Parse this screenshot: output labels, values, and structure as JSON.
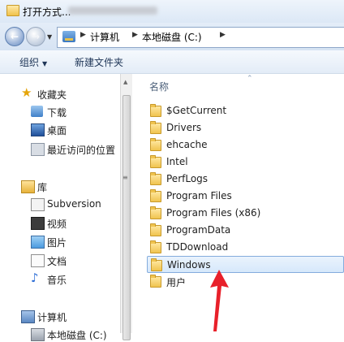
{
  "window": {
    "title": "打开方式..."
  },
  "address": {
    "crumbs": [
      "计算机",
      "本地磁盘 (C:)"
    ]
  },
  "toolbar": {
    "organize_label": "组织",
    "new_folder_label": "新建文件夹"
  },
  "nav": {
    "favorites": {
      "header": "收藏夹",
      "items": [
        {
          "label": "下载",
          "icon": "download-icon"
        },
        {
          "label": "桌面",
          "icon": "desktop-icon"
        },
        {
          "label": "最近访问的位置",
          "icon": "recent-places-icon"
        }
      ]
    },
    "libraries": {
      "header": "库",
      "items": [
        {
          "label": "Subversion",
          "icon": "subversion-icon"
        },
        {
          "label": "视频",
          "icon": "video-icon"
        },
        {
          "label": "图片",
          "icon": "picture-icon"
        },
        {
          "label": "文档",
          "icon": "document-icon"
        },
        {
          "label": "音乐",
          "icon": "music-icon"
        }
      ]
    },
    "computer": {
      "header": "计算机",
      "items": [
        {
          "label": "本地磁盘 (C:)",
          "icon": "drive-icon"
        }
      ]
    }
  },
  "files": {
    "column_name": "名称",
    "selected_index": 9,
    "items": [
      "$GetCurrent",
      "Drivers",
      "ehcache",
      "Intel",
      "PerfLogs",
      "Program Files",
      "Program Files (x86)",
      "ProgramData",
      "TDDownload",
      "Windows",
      "用户"
    ]
  },
  "colors": {
    "selection_border": "#84acdd",
    "annotation_arrow": "#e8202a"
  }
}
